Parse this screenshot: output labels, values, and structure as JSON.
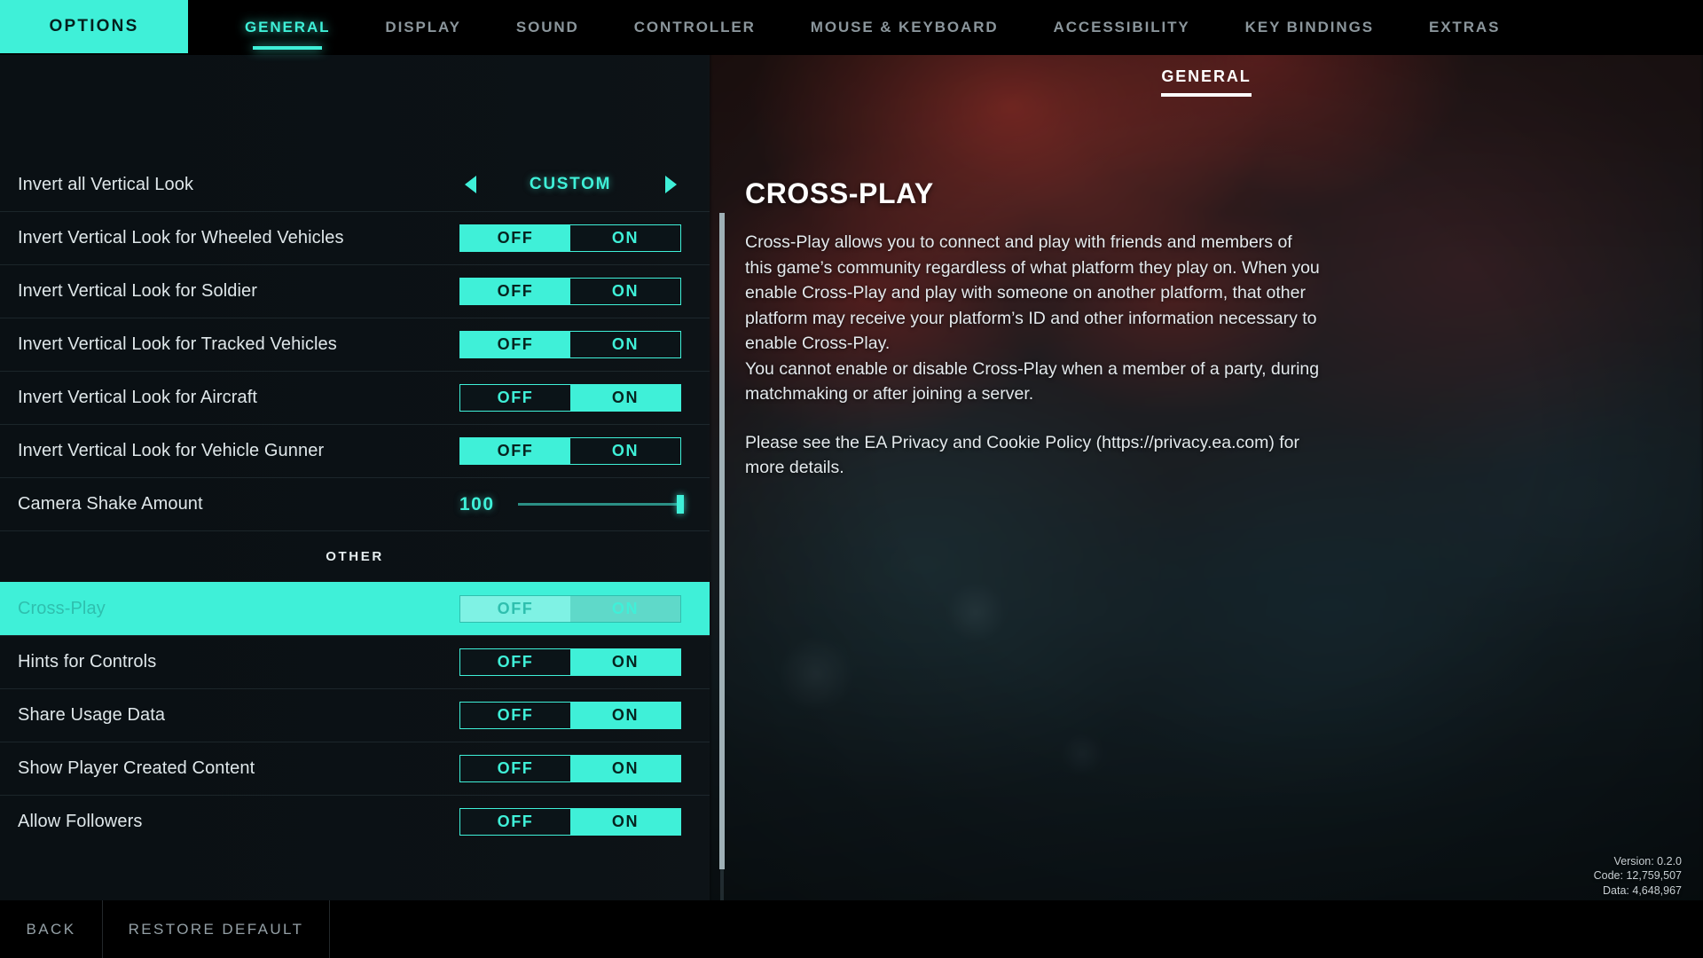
{
  "topbar": {
    "options_label": "OPTIONS",
    "tabs": [
      {
        "label": "GENERAL",
        "active": true
      },
      {
        "label": "DISPLAY",
        "active": false
      },
      {
        "label": "SOUND",
        "active": false
      },
      {
        "label": "CONTROLLER",
        "active": false
      },
      {
        "label": "MOUSE & KEYBOARD",
        "active": false
      },
      {
        "label": "ACCESSIBILITY",
        "active": false
      },
      {
        "label": "KEY BINDINGS",
        "active": false
      },
      {
        "label": "EXTRAS",
        "active": false
      }
    ]
  },
  "settings": {
    "rows": [
      {
        "type": "stepper",
        "label": "Invert all Vertical Look",
        "value": "CUSTOM",
        "left_arrow": "◀",
        "right_arrow": "▶"
      },
      {
        "type": "toggle",
        "label": "Invert Vertical Look for Wheeled Vehicles",
        "off_label": "OFF",
        "on_label": "ON",
        "selected": "OFF"
      },
      {
        "type": "toggle",
        "label": "Invert Vertical Look for Soldier",
        "off_label": "OFF",
        "on_label": "ON",
        "selected": "OFF"
      },
      {
        "type": "toggle",
        "label": "Invert Vertical Look for Tracked Vehicles",
        "off_label": "OFF",
        "on_label": "ON",
        "selected": "OFF"
      },
      {
        "type": "toggle",
        "label": "Invert Vertical Look for Aircraft",
        "off_label": "OFF",
        "on_label": "ON",
        "selected": "ON"
      },
      {
        "type": "toggle",
        "label": "Invert Vertical Look for Vehicle Gunner",
        "off_label": "OFF",
        "on_label": "ON",
        "selected": "OFF"
      },
      {
        "type": "slider",
        "label": "Camera Shake Amount",
        "value": "100",
        "min": 0,
        "max": 100,
        "percent": 100
      },
      {
        "type": "section",
        "label": "OTHER"
      },
      {
        "type": "toggle",
        "label": "Cross-Play",
        "off_label": "OFF",
        "on_label": "ON",
        "selected": "ON",
        "highlighted": true
      },
      {
        "type": "toggle",
        "label": "Hints for Controls",
        "off_label": "OFF",
        "on_label": "ON",
        "selected": "ON"
      },
      {
        "type": "toggle",
        "label": "Share Usage Data",
        "off_label": "OFF",
        "on_label": "ON",
        "selected": "ON"
      },
      {
        "type": "toggle",
        "label": "Show Player Created Content",
        "off_label": "OFF",
        "on_label": "ON",
        "selected": "ON"
      },
      {
        "type": "toggle",
        "label": "Allow Followers",
        "off_label": "OFF",
        "on_label": "ON",
        "selected": "ON"
      }
    ]
  },
  "detail": {
    "header": "GENERAL",
    "title": "CROSS-PLAY",
    "paragraphs": [
      "Cross-Play allows you to connect and play with friends and members of this game’s community regardless of what platform they play on. When you enable Cross-Play and play with someone on another platform, that other platform may receive your platform’s ID and other information necessary to enable Cross-Play.\nYou cannot enable or disable Cross-Play when a member of a party, during matchmaking or after joining a server.",
      "Please see the EA Privacy and Cookie Policy (https://privacy.ea.com) for more details."
    ]
  },
  "version": {
    "version_line": "Version: 0.2.0",
    "code_line": "Code: 12,759,507",
    "data_line": "Data: 4,648,967"
  },
  "bottombar": {
    "back_label": "BACK",
    "restore_label": "RESTORE DEFAULT"
  },
  "colors": {
    "accent": "#3ff0d8",
    "panel": "#0b1418",
    "text": "#dfe7ea"
  }
}
